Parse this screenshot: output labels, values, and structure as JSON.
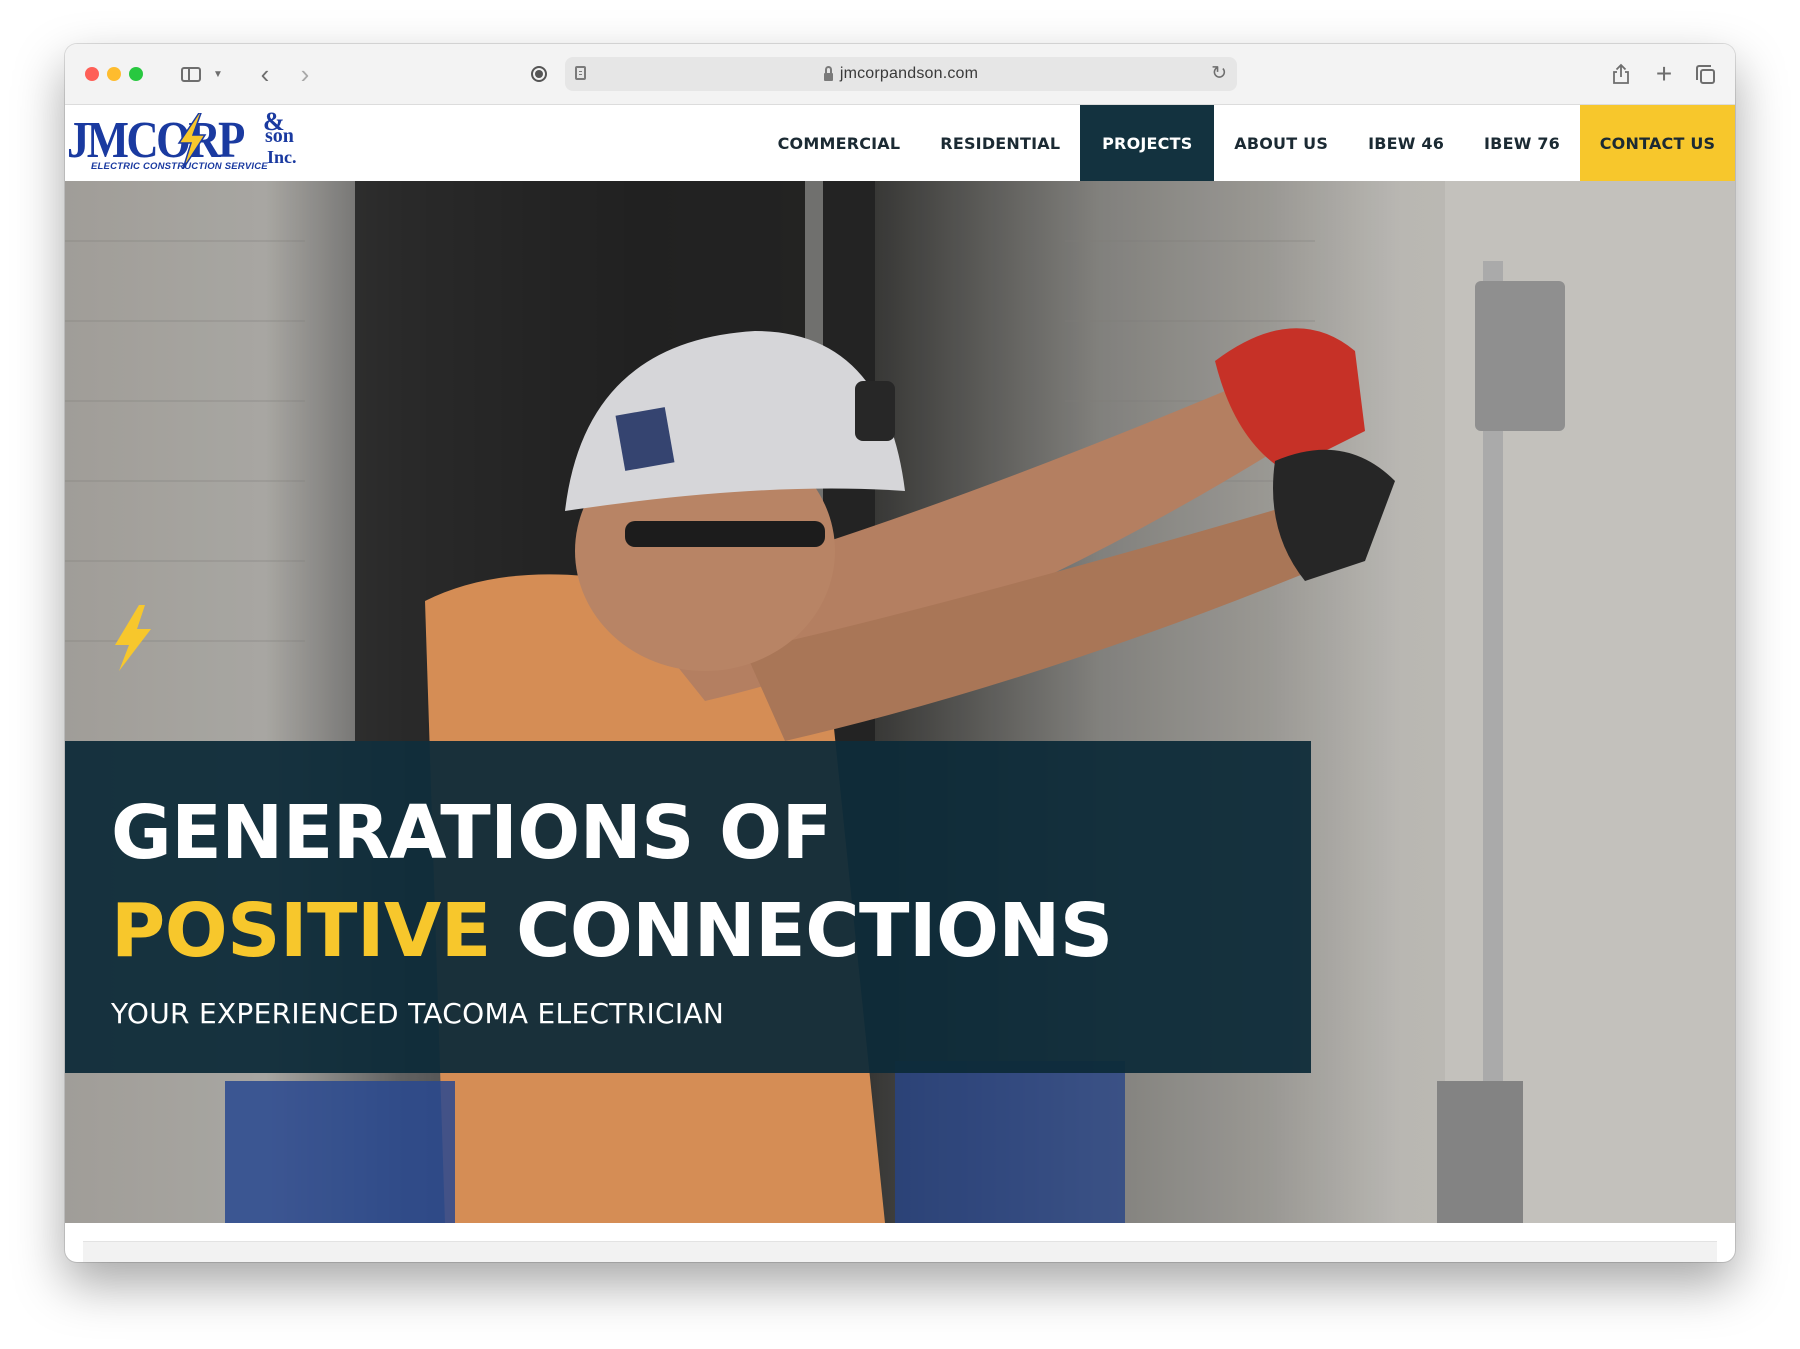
{
  "browser": {
    "url": "jmcorpandson.com"
  },
  "site": {
    "logo": {
      "main": "JMCORP",
      "amp": "&",
      "son": "son",
      "inc": "Inc.",
      "tagline": "ELECTRIC CONSTRUCTION SERVICE"
    },
    "nav": {
      "items": [
        {
          "label": "COMMERCIAL"
        },
        {
          "label": "RESIDENTIAL"
        },
        {
          "label": "PROJECTS",
          "active": true
        },
        {
          "label": "ABOUT US"
        },
        {
          "label": "IBEW 46"
        },
        {
          "label": "IBEW 76"
        }
      ],
      "contact_label": "CONTACT US"
    },
    "hero": {
      "line1": "GENERATIONS OF",
      "line2_highlight": "POSITIVE",
      "line2_rest": "CONNECTIONS",
      "subtitle": "YOUR EXPERIENCED TACOMA ELECTRICIAN"
    }
  },
  "colors": {
    "navy": "#13323f",
    "yellow": "#f7c72c",
    "logo_blue": "#1a3aa0",
    "nav_text": "#1b2a33"
  }
}
